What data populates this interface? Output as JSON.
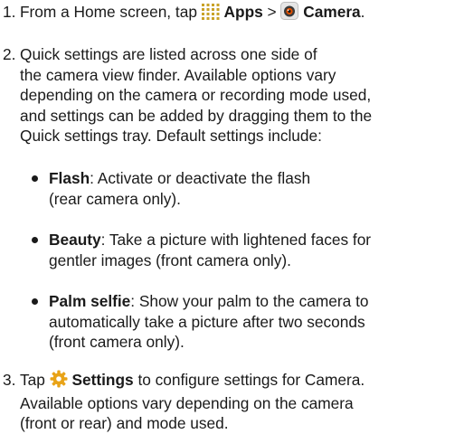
{
  "steps": [
    {
      "number": "1.",
      "lead": "From a Home screen, tap ",
      "apps_label": "Apps",
      "sep": " > ",
      "camera_label": "Camera",
      "end": "."
    },
    {
      "number": "2.",
      "lines": [
        "Quick settings are listed across one side of",
        "the camera view finder. Available options vary",
        "depending on the camera or recording mode used,",
        "and settings can be added by dragging them to the",
        "Quick settings tray. Default settings include:"
      ]
    },
    {
      "number": "3.",
      "lead": "Tap ",
      "settings_label": "Settings",
      "line1_rest": " to configure settings for Camera.",
      "lines": [
        "Available options vary depending on the camera",
        "(front or rear) and mode used."
      ]
    }
  ],
  "bullets": [
    {
      "term": "Flash",
      "first": ": Activate or deactivate the flash",
      "more": [
        "(rear camera only)."
      ]
    },
    {
      "term": "Beauty",
      "first": ": Take a picture with lightened faces for",
      "more": [
        "gentler images (front camera only)."
      ]
    },
    {
      "term": "Palm selfie",
      "first": ": Show your palm to the camera to",
      "more": [
        "automatically take a picture after two seconds",
        "(front camera only)."
      ]
    }
  ],
  "icons": {
    "apps": "apps-grid-icon",
    "camera": "camera-app-icon",
    "settings": "settings-gear-icon"
  },
  "colors": {
    "text": "#1a1a1a",
    "apps_icon": "#c9a227",
    "settings_icon": "#e8a317"
  }
}
